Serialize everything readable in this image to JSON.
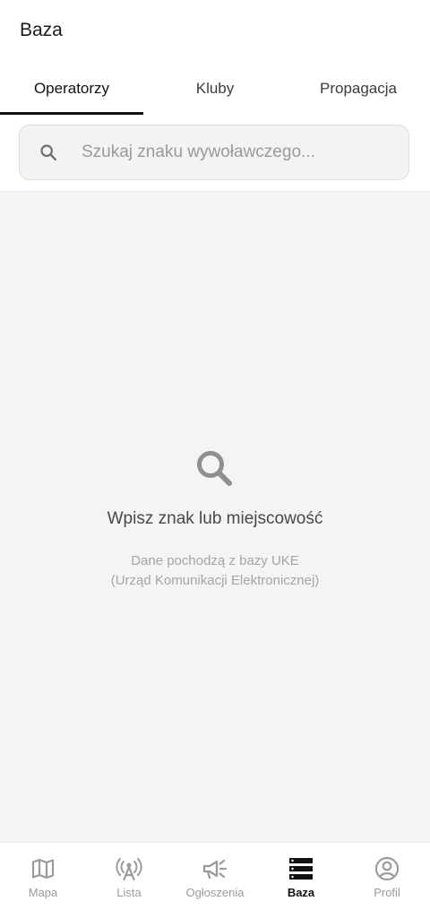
{
  "app_bar": {
    "title": "Baza"
  },
  "tabs": [
    {
      "label": "Operatorzy",
      "active": true
    },
    {
      "label": "Kluby",
      "active": false
    },
    {
      "label": "Propagacja",
      "active": false
    }
  ],
  "search": {
    "placeholder": "Szukaj znaku wywoławczego...",
    "value": "",
    "icon": "search-icon"
  },
  "empty_state": {
    "icon": "search-icon",
    "title": "Wpisz znak lub miejscowość",
    "subtitle_line1": "Dane pochodzą z bazy UKE",
    "subtitle_line2": "(Urząd Komunikacji Elektronicznej)"
  },
  "bottom_nav": [
    {
      "label": "Mapa",
      "icon": "map-icon",
      "active": false
    },
    {
      "label": "Lista",
      "icon": "antenna-icon",
      "active": false
    },
    {
      "label": "Ogłoszenia",
      "icon": "megaphone-icon",
      "active": false
    },
    {
      "label": "Baza",
      "icon": "database-icon",
      "active": true
    },
    {
      "label": "Profil",
      "icon": "profile-icon",
      "active": false
    }
  ],
  "colors": {
    "accent": "#111111",
    "inactive": "#9b9b9b",
    "background": "#f4f4f2"
  }
}
